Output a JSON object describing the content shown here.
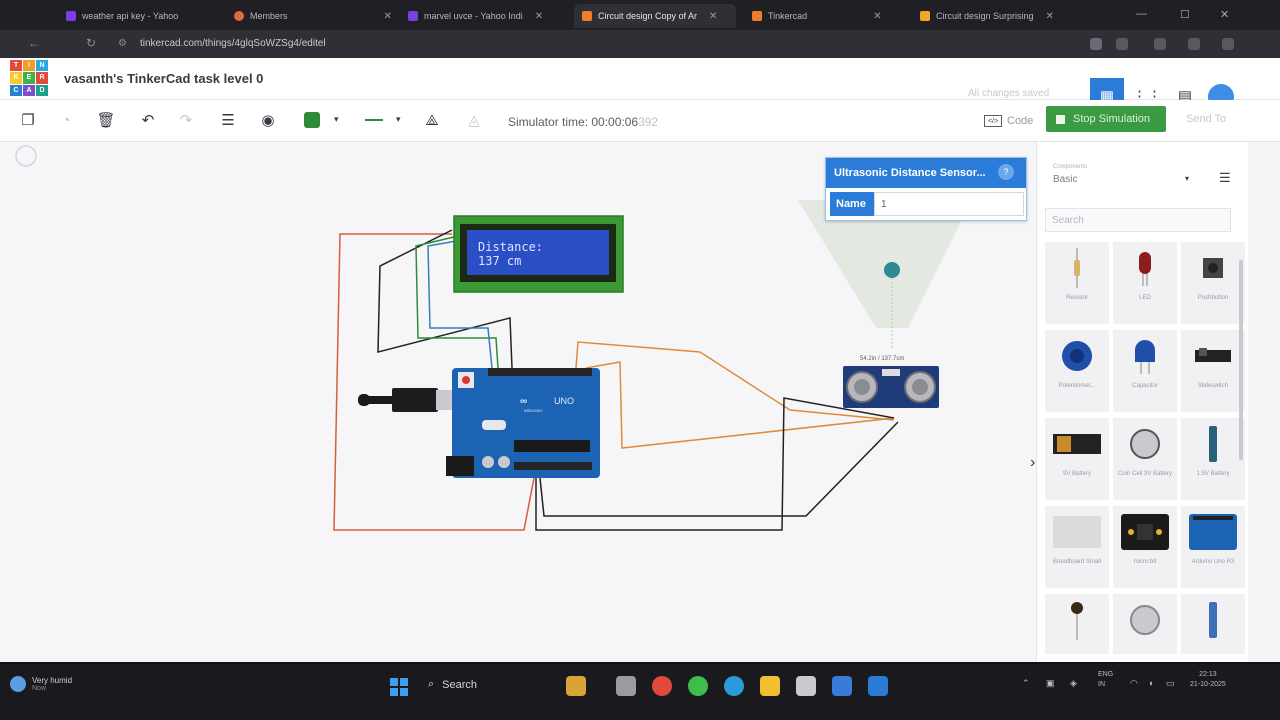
{
  "browser": {
    "tabs": [
      {
        "label": "weather api key - Yahoo",
        "color": "#7b3fe4"
      },
      {
        "label": "Members",
        "color": "#e06b3a"
      },
      {
        "label": "marvel uvce - Yahoo Indi",
        "color": "#7b3fe4"
      },
      {
        "label": "Circuit design Copy of Ar",
        "color": "#f07c28"
      },
      {
        "label": "Tinkercad",
        "color": "#f07c28"
      },
      {
        "label": "Circuit design Surprising",
        "color": "#f0a828"
      }
    ],
    "url": "tinkercad.com/things/4glqSoWZSg4/editel"
  },
  "app": {
    "logo_letters": [
      "T",
      "I",
      "N",
      "K",
      "E",
      "R",
      "C",
      "A",
      "D"
    ],
    "logo_colors": [
      "#e24a3b",
      "#f49b2a",
      "#2aa8e0",
      "#f7c82d",
      "#3cb44a",
      "#e24a3b",
      "#2a7fd4",
      "#7b4fc9",
      "#1ea18c"
    ],
    "project_title": "vasanth's TinkerCad task level 0",
    "save_status": "All changes saved",
    "simulator_time_label": "Simulator time: 00:00:06",
    "simulator_time_ms": "392",
    "code_label": "Code",
    "code_icon_glyph": "</>",
    "stop_label": "Stop Simulation",
    "send_label": "Send To"
  },
  "lcd": {
    "line1": "Distance:",
    "line2": "137 cm"
  },
  "sensor": {
    "readout": "54.2in / 137.7cm"
  },
  "inspector": {
    "title": "Ultrasonic Distance Sensor...",
    "name_label": "Name",
    "name_value": "1",
    "help": "?"
  },
  "arduino": {
    "board_label": "UNO",
    "brand_label": "ARDUINO"
  },
  "panel": {
    "category_caption": "Components",
    "category_value": "Basic",
    "search_placeholder": "Search",
    "components": [
      {
        "label": "Resistor"
      },
      {
        "label": "LED"
      },
      {
        "label": "Pushbutton"
      },
      {
        "label": "Potentiomet..."
      },
      {
        "label": "Capacitor"
      },
      {
        "label": "Slideswitch"
      },
      {
        "label": "9V Battery"
      },
      {
        "label": "Coin Cell 3V Battery"
      },
      {
        "label": "1.5V Battery"
      },
      {
        "label": "Breadboard Small"
      },
      {
        "label": "micro:bit"
      },
      {
        "label": "Arduino Uno R3"
      }
    ]
  },
  "taskbar": {
    "weather_title": "Very humid",
    "weather_sub": "Now",
    "search_label": "Search",
    "lang": "ENG",
    "lang_sub": "IN",
    "time": "22:13",
    "date": "21-10-2025"
  },
  "colors": {
    "accent": "#2b7bd8",
    "sim_green": "#3a9b44",
    "wire_red": "#d4603a",
    "wire_orange": "#e08a3c",
    "wire_black": "#222222"
  }
}
